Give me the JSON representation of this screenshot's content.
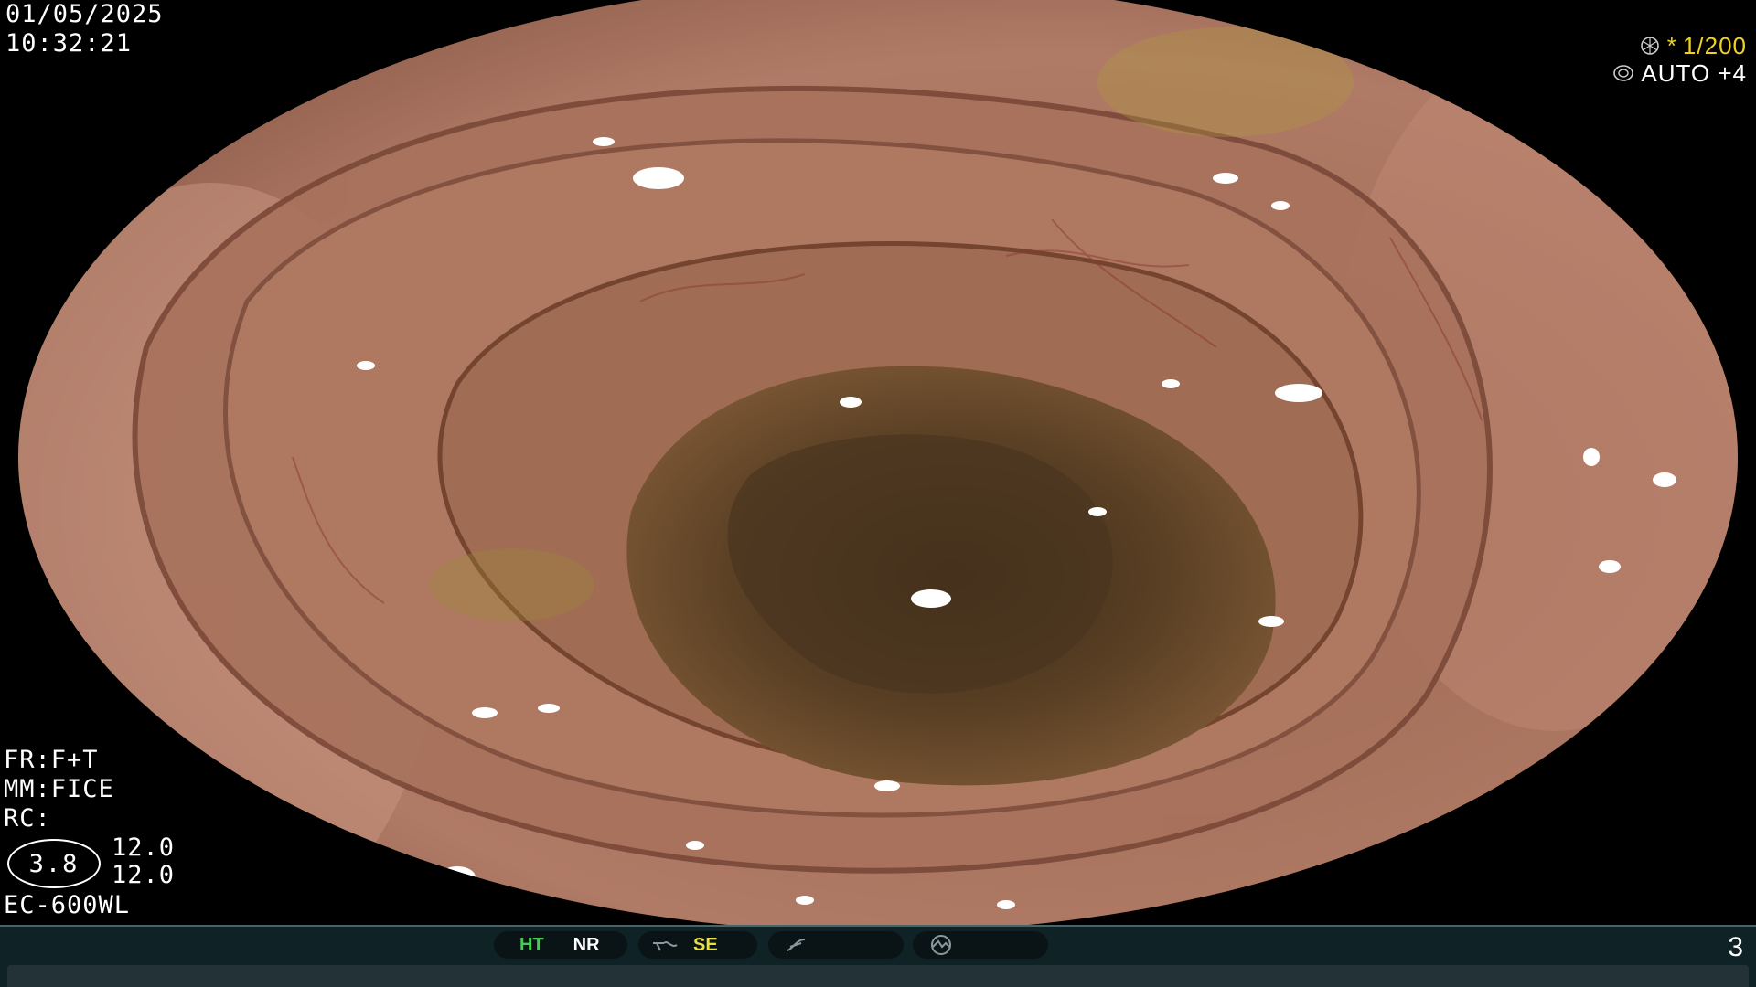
{
  "header": {
    "date": "01/05/2025",
    "time": "10:32:21"
  },
  "camera": {
    "shutter_star": "*",
    "shutter_value": "1/200",
    "iris_mode": "AUTO +4"
  },
  "settings": {
    "fr": "FR:F+T",
    "mm": "MM:FICE",
    "rc": "RC:",
    "zoom": "3.8",
    "enhance_1": "12.0",
    "enhance_2": "12.0",
    "scope_model": "EC-600WL"
  },
  "statusbar": {
    "ht": "HT",
    "nr": "NR",
    "se": "SE",
    "page": "3"
  },
  "colors": {
    "ht": "#40d050",
    "se": "#e8e040",
    "shutter": "#f0d020",
    "bar": "#0f2226"
  },
  "icons": [
    "shutter-icon",
    "iris-icon",
    "structure-icon",
    "freeze-icon",
    "scan-icon"
  ]
}
